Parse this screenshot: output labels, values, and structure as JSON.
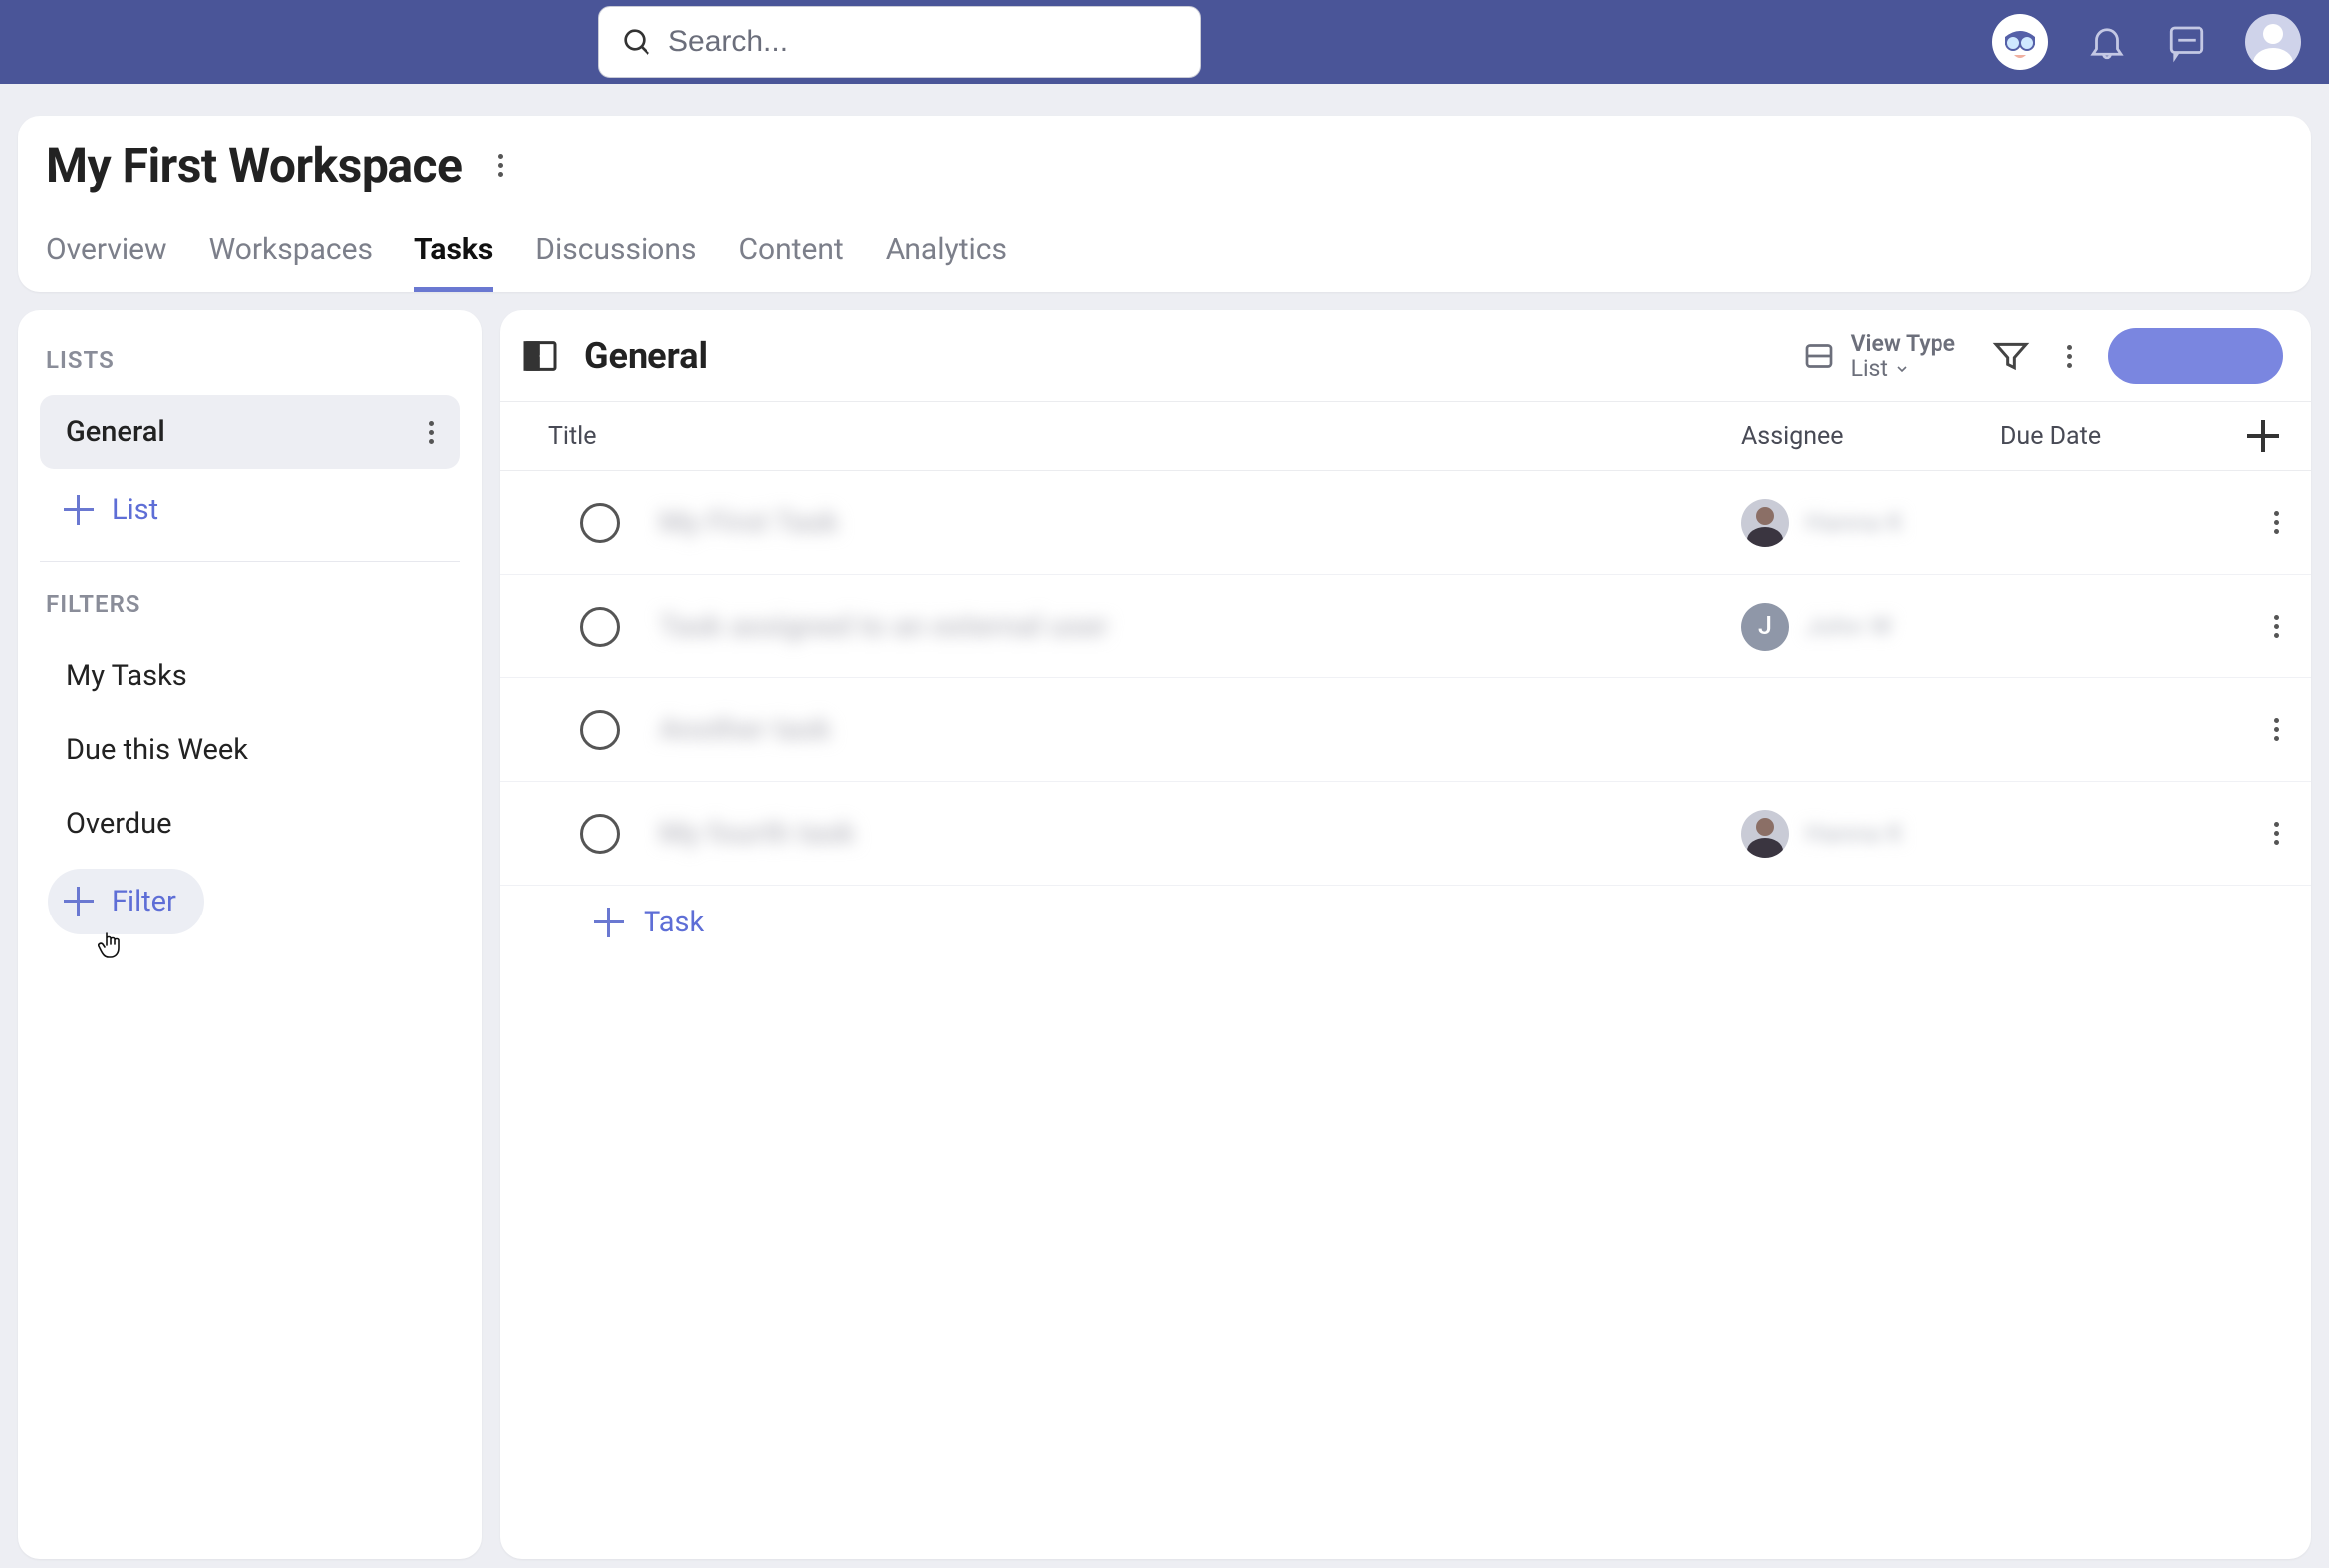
{
  "topbar": {
    "search_placeholder": "Search..."
  },
  "workspace": {
    "title": "My First Workspace",
    "tabs": [
      "Overview",
      "Workspaces",
      "Tasks",
      "Discussions",
      "Content",
      "Analytics"
    ],
    "active_tab_index": 2
  },
  "sidebar": {
    "lists_heading": "LISTS",
    "lists": [
      {
        "label": "General",
        "selected": true
      }
    ],
    "add_list_label": "List",
    "filters_heading": "FILTERS",
    "filters": [
      {
        "label": "My Tasks"
      },
      {
        "label": "Due this Week"
      },
      {
        "label": "Overdue"
      }
    ],
    "add_filter_label": "Filter"
  },
  "content": {
    "list_title": "General",
    "view_type_label": "View Type",
    "view_type_value": "List",
    "primary_button_label": "",
    "columns": {
      "title": "Title",
      "assignee": "Assignee",
      "due": "Due Date"
    },
    "tasks": [
      {
        "title": "My First Task",
        "assignee_name": "Hanna K",
        "assignee_kind": "person"
      },
      {
        "title": "Task assigned to an external user",
        "assignee_name": "John W",
        "assignee_kind": "letter",
        "assignee_initial": "J"
      },
      {
        "title": "Another task",
        "assignee_name": "",
        "assignee_kind": "none"
      },
      {
        "title": "My fourth task",
        "assignee_name": "Hanna K",
        "assignee_kind": "person"
      }
    ],
    "add_task_label": "Task"
  }
}
